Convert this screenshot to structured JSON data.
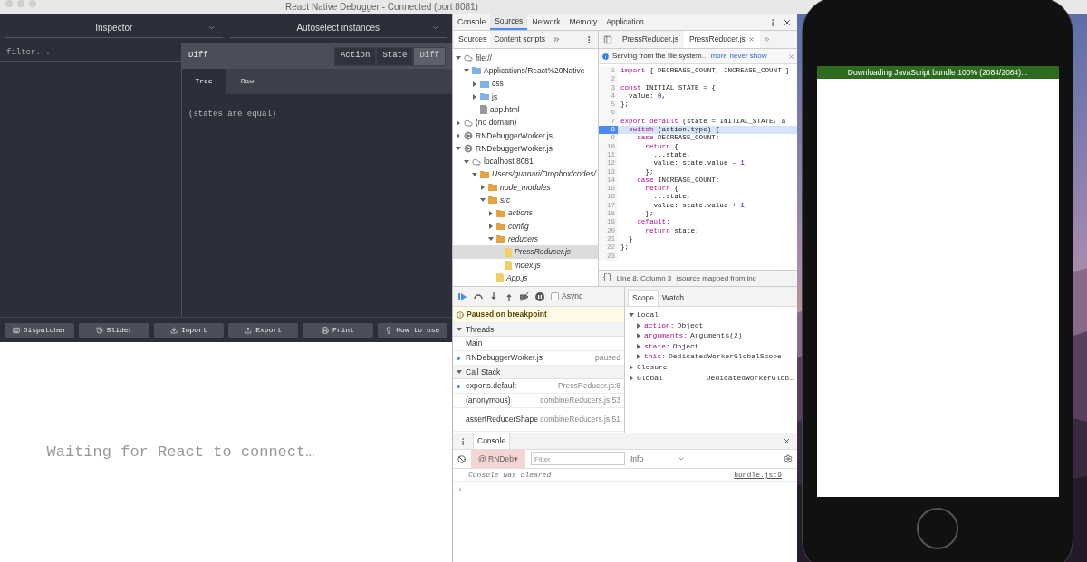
{
  "window": {
    "title": "React Native Debugger - Connected (port 8081)"
  },
  "inspector": {
    "selectors": [
      "Inspector",
      "Autoselect instances"
    ],
    "filter": {
      "placeholder": "filter..."
    },
    "header": {
      "title": "Diff",
      "modes": [
        {
          "label": "Action",
          "selected": false
        },
        {
          "label": "State",
          "selected": false
        },
        {
          "label": "Diff",
          "selected": true
        }
      ]
    },
    "tabs": [
      {
        "label": "Tree",
        "selected": true
      },
      {
        "label": "Raw",
        "selected": false
      }
    ],
    "content": "(states are equal)",
    "buttons": [
      {
        "label": "Dispatcher",
        "kind": "keyboard"
      },
      {
        "label": "Slider",
        "kind": "history"
      },
      {
        "label": "Import",
        "kind": "download"
      },
      {
        "label": "Export",
        "kind": "upload"
      },
      {
        "label": "Print",
        "kind": "printer"
      },
      {
        "label": "How to use",
        "kind": "bulb"
      }
    ]
  },
  "react_devtools": {
    "message": "Waiting for React to connect…"
  },
  "devtools": {
    "tabs": [
      {
        "label": "Console",
        "selected": false
      },
      {
        "label": "Sources",
        "selected": true
      },
      {
        "label": "Network",
        "selected": false
      },
      {
        "label": "Memory",
        "selected": false
      },
      {
        "label": "Application",
        "selected": false
      }
    ],
    "navigator": {
      "tabs": [
        {
          "label": "Sources",
          "selected": true
        },
        {
          "label": "Content scripts",
          "selected": false
        }
      ],
      "tree": [
        {
          "label": "file://",
          "kind": "domain",
          "expanded": true,
          "selected": false,
          "children": [
            {
              "label": "Applications/React%20Native",
              "kind": "folder",
              "expanded": true,
              "selected": false,
              "children": [
                {
                  "label": "css",
                  "kind": "folder",
                  "expanded": false,
                  "selected": false
                },
                {
                  "label": "js",
                  "kind": "folder",
                  "expanded": false,
                  "selected": false
                },
                {
                  "label": "app.html",
                  "kind": "file",
                  "selected": false
                }
              ]
            }
          ]
        },
        {
          "label": "(no domain)",
          "kind": "domain",
          "expanded": false,
          "selected": false
        },
        {
          "label": "RNDebuggerWorker.js",
          "kind": "worker",
          "expanded": false,
          "selected": false
        },
        {
          "label": "RNDebuggerWorker.js",
          "kind": "worker",
          "expanded": true,
          "selected": false,
          "children": [
            {
              "label": "localhost:8081",
              "kind": "domain",
              "expanded": true,
              "selected": false,
              "children": [
                {
                  "label": "Users/gunnari/Dropbox/codes/",
                  "kind": "mapped-folder",
                  "expanded": true,
                  "selected": false,
                  "children": [
                    {
                      "label": "node_modules",
                      "kind": "mapped-folder",
                      "expanded": false,
                      "selected": false
                    },
                    {
                      "label": "src",
                      "kind": "mapped-folder",
                      "expanded": true,
                      "selected": false,
                      "children": [
                        {
                          "label": "actions",
                          "kind": "mapped-folder",
                          "expanded": false,
                          "selected": false
                        },
                        {
                          "label": "config",
                          "kind": "mapped-folder",
                          "expanded": false,
                          "selected": false
                        },
                        {
                          "label": "reducers",
                          "kind": "mapped-folder",
                          "expanded": true,
                          "selected": false,
                          "children": [
                            {
                              "label": "PressReducer.js",
                              "kind": "mapped-file",
                              "selected": true
                            },
                            {
                              "label": "index.js",
                              "kind": "mapped-file",
                              "selected": false
                            }
                          ]
                        },
                        {
                          "label": "App.js",
                          "kind": "mapped-file",
                          "selected": false
                        }
                      ]
                    }
                  ]
                }
              ]
            }
          ]
        }
      ]
    },
    "editor": {
      "tabs": [
        {
          "label": "PressReducer.js",
          "selected": false
        },
        {
          "label": "PressReducer.js",
          "selected": true
        }
      ],
      "infobar": {
        "text": "Serving from the file system...",
        "links": [
          "more",
          "never show"
        ]
      },
      "lines": [
        {
          "num": "1",
          "breakpoint": false,
          "tokens": [
            {
              "t": "import",
              "kind": "keyword"
            },
            {
              "t": " { DECREASE_COUNT, INCREASE_COUNT }",
              "kind": "plain"
            }
          ]
        },
        {
          "num": "2",
          "breakpoint": false
        },
        {
          "num": "3",
          "breakpoint": false,
          "tokens": [
            {
              "t": "const",
              "kind": "keyword"
            },
            {
              "t": " INITIAL_STATE = {",
              "kind": "plain"
            }
          ]
        },
        {
          "num": "4",
          "breakpoint": false,
          "tokens": [
            {
              "t": "  value: ",
              "kind": "plain"
            },
            {
              "t": "0",
              "kind": "number"
            },
            {
              "t": ",",
              "kind": "plain"
            }
          ]
        },
        {
          "num": "5",
          "breakpoint": false,
          "tokens": [
            {
              "t": "};",
              "kind": "plain"
            }
          ]
        },
        {
          "num": "6",
          "breakpoint": false
        },
        {
          "num": "7",
          "breakpoint": false,
          "tokens": [
            {
              "t": "export default",
              "kind": "keyword"
            },
            {
              "t": " (state = INITIAL_STATE, a",
              "kind": "plain"
            }
          ]
        },
        {
          "num": "8",
          "breakpoint": true,
          "tokens": [
            {
              "t": "  switch",
              "kind": "keyword"
            },
            {
              "t": " (action.type) {",
              "kind": "plain"
            }
          ]
        },
        {
          "num": "9",
          "breakpoint": false,
          "tokens": [
            {
              "t": "    case",
              "kind": "keyword"
            },
            {
              "t": " DECREASE_COUNT:",
              "kind": "plain"
            }
          ]
        },
        {
          "num": "10",
          "breakpoint": false,
          "tokens": [
            {
              "t": "      return",
              "kind": "keyword"
            },
            {
              "t": " {",
              "kind": "plain"
            }
          ]
        },
        {
          "num": "11",
          "breakpoint": false,
          "tokens": [
            {
              "t": "        ...state,",
              "kind": "plain"
            }
          ]
        },
        {
          "num": "12",
          "breakpoint": false,
          "tokens": [
            {
              "t": "        value: state.value - ",
              "kind": "plain"
            },
            {
              "t": "1",
              "kind": "number"
            },
            {
              "t": ",",
              "kind": "plain"
            }
          ]
        },
        {
          "num": "13",
          "breakpoint": false,
          "tokens": [
            {
              "t": "      };",
              "kind": "plain"
            }
          ]
        },
        {
          "num": "14",
          "breakpoint": false,
          "tokens": [
            {
              "t": "    case",
              "kind": "keyword"
            },
            {
              "t": " INCREASE_COUNT:",
              "kind": "plain"
            }
          ]
        },
        {
          "num": "15",
          "breakpoint": false,
          "tokens": [
            {
              "t": "      return",
              "kind": "keyword"
            },
            {
              "t": " {",
              "kind": "plain"
            }
          ]
        },
        {
          "num": "16",
          "breakpoint": false,
          "tokens": [
            {
              "t": "        ...state,",
              "kind": "plain"
            }
          ]
        },
        {
          "num": "17",
          "breakpoint": false,
          "tokens": [
            {
              "t": "        value: state.value + ",
              "kind": "plain"
            },
            {
              "t": "1",
              "kind": "number"
            },
            {
              "t": ",",
              "kind": "plain"
            }
          ]
        },
        {
          "num": "18",
          "breakpoint": false,
          "tokens": [
            {
              "t": "      };",
              "kind": "plain"
            }
          ]
        },
        {
          "num": "19",
          "breakpoint": false,
          "tokens": [
            {
              "t": "    default:",
              "kind": "keyword"
            }
          ]
        },
        {
          "num": "20",
          "breakpoint": false,
          "tokens": [
            {
              "t": "      return",
              "kind": "keyword"
            },
            {
              "t": " state;",
              "kind": "plain"
            }
          ]
        },
        {
          "num": "21",
          "breakpoint": false,
          "tokens": [
            {
              "t": "  }",
              "kind": "plain"
            }
          ]
        },
        {
          "num": "22",
          "breakpoint": false,
          "tokens": [
            {
              "t": "};",
              "kind": "plain"
            }
          ]
        },
        {
          "num": "23",
          "breakpoint": false
        }
      ],
      "status": {
        "format": "{}",
        "position": "Line 8, Column 3",
        "source": "(source mapped from inc"
      }
    },
    "debugger": {
      "async": {
        "label": "Async",
        "checked": false
      },
      "banner": "Paused on breakpoint",
      "threads": {
        "title": "Threads",
        "expanded": true,
        "items": [
          {
            "name": "Main",
            "current": false
          },
          {
            "name": "RNDebuggerWorker.js",
            "status": "paused",
            "current": true
          }
        ]
      },
      "call_stack": {
        "title": "Call Stack",
        "expanded": true,
        "frames": [
          {
            "name": "exports.default",
            "location": "PressReducer.js:8",
            "current": true
          },
          {
            "name": "(anonymous)",
            "location": "combineReducers.js:53",
            "current": false
          },
          {
            "name": "assertReducerShape",
            "location": "combineReducers.js:51",
            "current": false
          }
        ]
      },
      "scope_tabs": [
        {
          "label": "Scope",
          "selected": true
        },
        {
          "label": "Watch",
          "selected": false
        }
      ],
      "scope": [
        {
          "name": "Local",
          "expanded": true,
          "children": [
            {
              "name": "action:",
              "value": "Object",
              "expanded": false
            },
            {
              "name": "arguments:",
              "value": "Arguments(2)",
              "expanded": false
            },
            {
              "name": "state:",
              "value": "Object",
              "expanded": false
            },
            {
              "name": "this:",
              "value": "DedicatedWorkerGlobalScope",
              "expanded": false
            }
          ]
        },
        {
          "name": "Closure",
          "expanded": false
        },
        {
          "name": "Global",
          "value": "DedicatedWorkerGlob…",
          "expanded": false
        }
      ]
    },
    "console": {
      "tab": "Console",
      "context": "@ RNDeb▾",
      "filter": {
        "placeholder": "Filter"
      },
      "level": "Info",
      "messages": [
        {
          "text": "Console was cleared",
          "source": "bundle.js:9"
        }
      ],
      "prompt": "›"
    }
  },
  "simulator": {
    "banner": "Downloading JavaScript bundle 100% (2084/2084)..."
  }
}
